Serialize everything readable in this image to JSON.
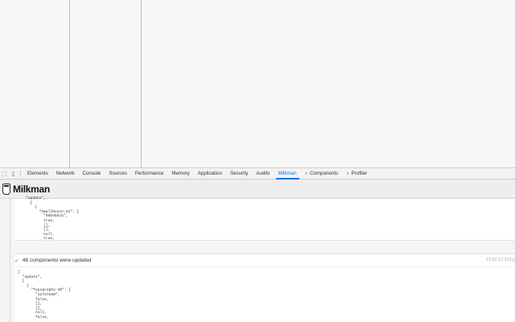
{
  "devtools": {
    "tabs": [
      "Elements",
      "Network",
      "Console",
      "Sources",
      "Performance",
      "Memory",
      "Application",
      "Security",
      "Audits",
      "Milkman",
      "Components",
      "Profiler"
    ],
    "active_tab": "Milkman"
  },
  "app": {
    "name": "Milkman"
  },
  "log": {
    "first_card_code": "\"update\",\n  [\n    {\n      \"SmallRoute-22\": [\n        \"98bebbcb\",\n        true,\n        [],\n        [],\n        null,\n        true,",
    "entry": {
      "message": "48 components were updated",
      "time": "13:52:13.313 p",
      "code": "[\n  \"update\",\n  [\n    {\n      \"Typography-30\": [\n        \"12737e80\",\n        false,\n        [],\n        [],\n        null,\n        false,"
    }
  }
}
